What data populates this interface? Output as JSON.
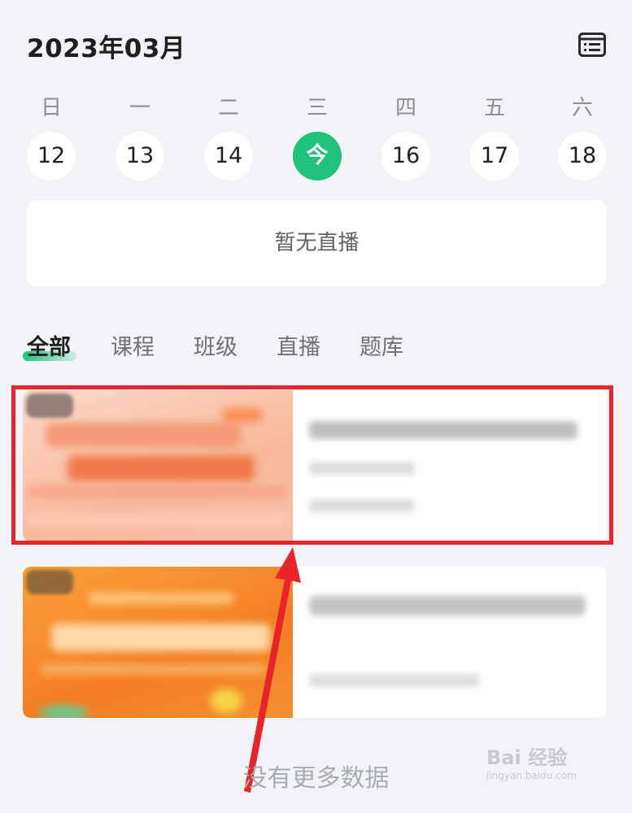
{
  "header": {
    "title": "2023年03月",
    "list_icon": "list-icon"
  },
  "week": {
    "weekdays": [
      "日",
      "一",
      "二",
      "三",
      "四",
      "五",
      "六"
    ],
    "days": [
      "12",
      "13",
      "14",
      "今",
      "16",
      "17",
      "18"
    ],
    "today_index": 3
  },
  "live": {
    "empty_text": "暂无直播"
  },
  "tabs": {
    "items": [
      {
        "label": "全部",
        "active": true
      },
      {
        "label": "课程",
        "active": false
      },
      {
        "label": "班级",
        "active": false
      },
      {
        "label": "直播",
        "active": false
      },
      {
        "label": "题库",
        "active": false
      }
    ]
  },
  "footer": {
    "no_more": "没有更多数据"
  },
  "watermark": {
    "brand": "Bai 经验",
    "url": "jingyan.baidu.com"
  },
  "colors": {
    "accent": "#1ec27a",
    "highlight": "#e8232a",
    "arrow": "#e8232a"
  }
}
